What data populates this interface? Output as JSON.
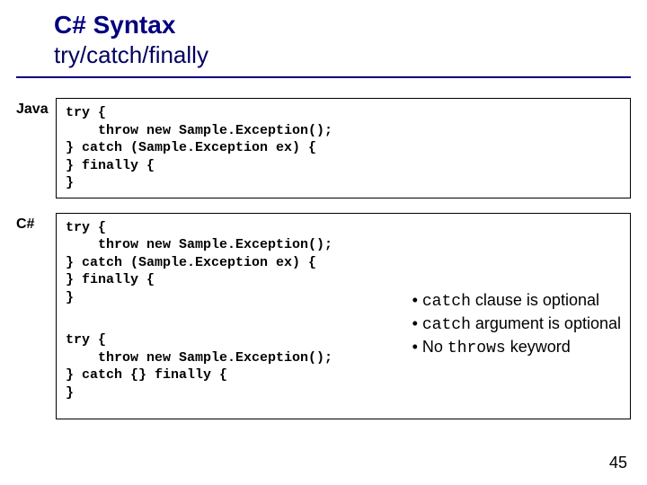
{
  "header": {
    "title": "C# Syntax",
    "subtitle": "try/catch/finally"
  },
  "java": {
    "label": "Java",
    "code": "try {\n    throw new Sample.Exception();\n} catch (Sample.Exception ex) {\n} finally {\n}"
  },
  "csharp": {
    "label": "C#",
    "code1": "try {\n    throw new Sample.Exception();\n} catch (Sample.Exception ex) {\n} finally {\n}",
    "code2": "try {\n    throw new Sample.Exception();\n} catch {} finally {\n}",
    "notes": {
      "n1_pre": "• ",
      "n1_mono": "catch",
      "n1_post": " clause is optional",
      "n2_pre": "• ",
      "n2_mono": "catch",
      "n2_post": " argument is optional",
      "n3_pre": "• No ",
      "n3_mono": "throws",
      "n3_post": " keyword"
    }
  },
  "page_number": "45"
}
